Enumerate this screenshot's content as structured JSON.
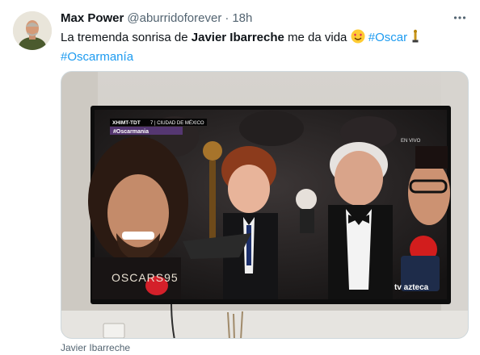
{
  "tweet": {
    "author_name": "Max Power",
    "handle": "@aburridoforever",
    "separator": "·",
    "time": "18h",
    "text_before": "La tremenda sonrisa de ",
    "text_bold": "Javier Ibarreche",
    "text_after": " me da vida ",
    "hashtag_1": "#Oscar",
    "hashtag_2": "#Oscarmanía",
    "more_icon": "ellipsis-icon"
  },
  "media": {
    "tv_channel": "XHIMT-TDT",
    "tv_location": "7 | CIUDAD DE MÉXICO",
    "tv_hashtag": "#Oscarmania",
    "tv_live": "EN VIVO",
    "tv_logo": "OSCARS95",
    "tv_brand": "tv azteca"
  },
  "caption": "Javier Ibarreche",
  "colors": {
    "link": "#1d9bf0",
    "text": "#0f1419",
    "secondary": "#536471"
  }
}
